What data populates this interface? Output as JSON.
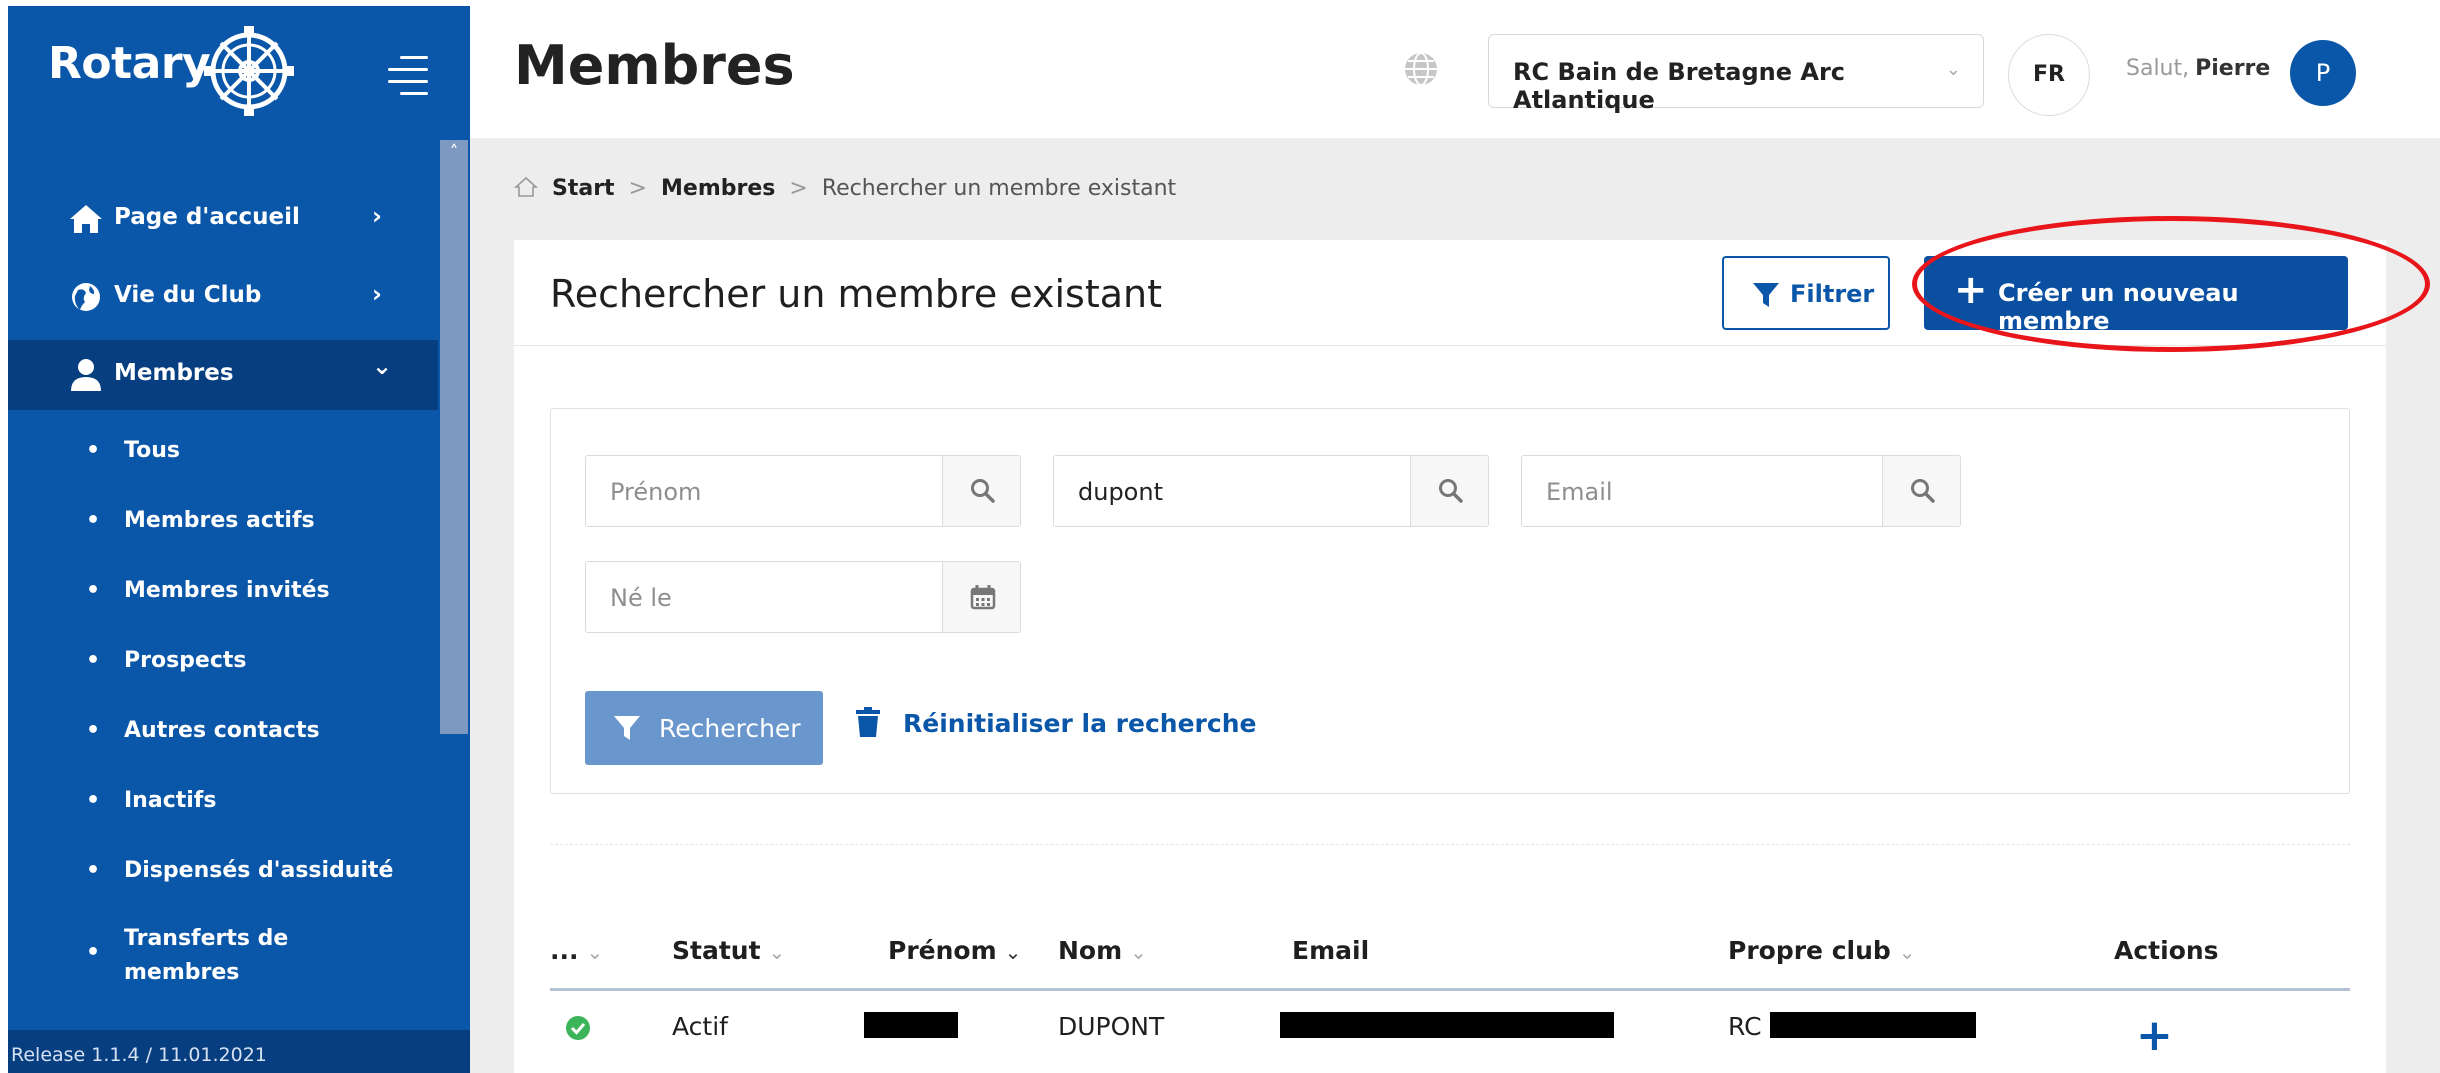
{
  "app": {
    "logo_text": "Rotary",
    "release": "Release 1.1.4 / 11.01.2021"
  },
  "sidebar": {
    "items": [
      {
        "label": "Page d'accueil",
        "icon": "home-icon",
        "chevron": "›"
      },
      {
        "label": "Vie du Club",
        "icon": "globe-icon",
        "chevron": "›"
      },
      {
        "label": "Membres",
        "icon": "user-icon",
        "chevron": "⌄",
        "active": true
      }
    ],
    "subitems": [
      "Tous",
      "Membres actifs",
      "Membres invités",
      "Prospects",
      "Autres contacts",
      "Inactifs",
      "Dispensés d'assiduité",
      "Transferts de membres"
    ]
  },
  "header": {
    "title": "Membres",
    "club": "RC Bain de Bretagne Arc Atlantique",
    "lang": "FR",
    "greeting": "Salut,",
    "user": "Pierre",
    "avatar_initial": "P"
  },
  "breadcrumb": {
    "items": [
      "Start",
      "Membres",
      "Rechercher un membre existant"
    ]
  },
  "card": {
    "title": "Rechercher un membre existant",
    "filter_label": "Filtrer",
    "create_label": "Créer un nouveau membre"
  },
  "search": {
    "firstname_placeholder": "Prénom",
    "name_value": "dupont",
    "email_placeholder": "Email",
    "birth_placeholder": "Né le",
    "search_label": "Rechercher",
    "reset_label": "Réinitialiser la recherche"
  },
  "table": {
    "columns": [
      "...",
      "Statut",
      "Prénom",
      "Nom",
      "Email",
      "Propre club",
      "Actions"
    ],
    "rows": [
      {
        "status": "Actif",
        "nom": "DUPONT",
        "club_prefix": "RC",
        "action": "+"
      }
    ]
  },
  "colors": {
    "brand": "#0a56a8",
    "highlight": "#e8151b",
    "status_active": "#3cb55a"
  }
}
